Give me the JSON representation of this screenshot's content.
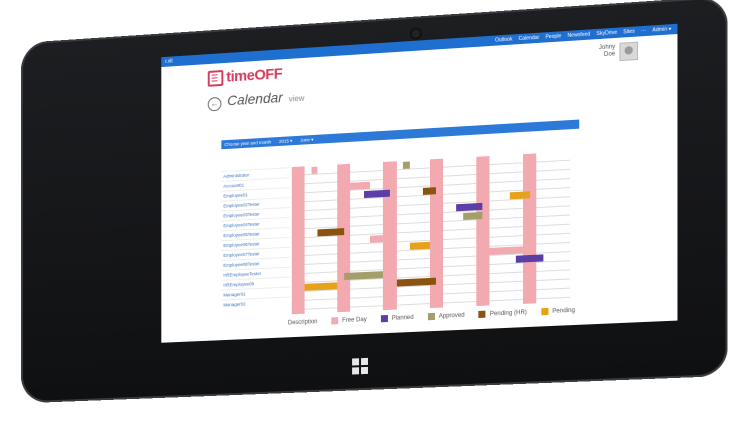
{
  "topbar": {
    "left": "r.xlt",
    "nav": [
      "Outlook",
      "Calendar",
      "People",
      "Newsfeed",
      "SkyDrive",
      "Sites",
      "···",
      "Admin ▾"
    ]
  },
  "app": {
    "logo": "timeOFF"
  },
  "user": {
    "first": "Johny",
    "last": "Doe"
  },
  "page": {
    "title": "Calendar",
    "subtitle": "view",
    "back_icon": "←"
  },
  "filters": [
    "Choose year and month",
    "2015 ▾",
    "June ▾"
  ],
  "employees": [
    "Administrator",
    "Account01",
    "Employee01",
    "Employee02Tester",
    "Employee03Tester",
    "Employee04Tester",
    "Employee05Tester",
    "Employee06Tester",
    "Employee07Tester",
    "Employee08Tester",
    "HREmployeeTester",
    "HREmployee08",
    "Manager01",
    "Manager02"
  ],
  "legend": {
    "label": "Description",
    "items": [
      {
        "label": "Free Day",
        "color": "#f3a9b0"
      },
      {
        "label": "Planned",
        "color": "#5b3ea6"
      },
      {
        "label": "Approved",
        "color": "#a49e6a"
      },
      {
        "label": "Pending (HR)",
        "color": "#8a5410"
      },
      {
        "label": "Pending",
        "color": "#e6a21a"
      }
    ]
  },
  "colors": {
    "accent": "#1f6fd0",
    "brand": "#d63a5c"
  }
}
